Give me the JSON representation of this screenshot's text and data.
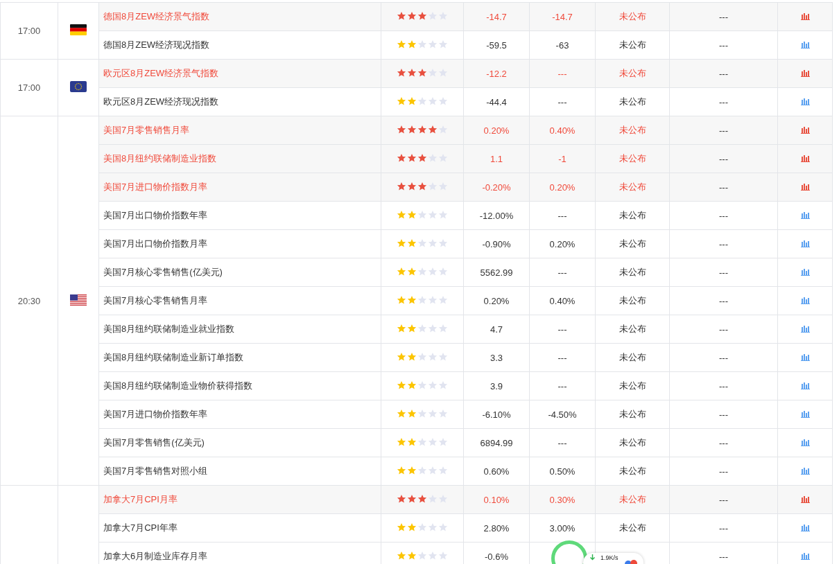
{
  "groups": [
    {
      "time": "17:00",
      "flag": {
        "kind": "de"
      },
      "rows": [
        {
          "name": "德国8月ZEW经济景气指数",
          "important": true,
          "stars": 3,
          "previous": "-14.7",
          "forecast": "-14.7",
          "actual": "未公布",
          "column_8": "---"
        },
        {
          "name": "德国8月ZEW经济现况指数",
          "important": false,
          "stars": 2,
          "previous": "-59.5",
          "forecast": "-63",
          "actual": "未公布",
          "column_8": "---"
        }
      ]
    },
    {
      "time": "17:00",
      "flag": {
        "kind": "eu"
      },
      "rows": [
        {
          "name": "欧元区8月ZEW经济景气指数",
          "important": true,
          "stars": 3,
          "previous": "-12.2",
          "forecast": "---",
          "actual": "未公布",
          "column_8": "---"
        },
        {
          "name": "欧元区8月ZEW经济现况指数",
          "important": false,
          "stars": 2,
          "previous": "-44.4",
          "forecast": "---",
          "actual": "未公布",
          "column_8": "---"
        }
      ]
    },
    {
      "time": "20:30",
      "flag": {
        "kind": "us"
      },
      "rows": [
        {
          "name": "美国7月零售销售月率",
          "important": true,
          "stars": 4,
          "previous": "0.20%",
          "forecast": "0.40%",
          "actual": "未公布",
          "column_8": "---"
        },
        {
          "name": "美国8月纽约联储制造业指数",
          "important": true,
          "stars": 3,
          "previous": "1.1",
          "forecast": "-1",
          "actual": "未公布",
          "column_8": "---"
        },
        {
          "name": "美国7月进口物价指数月率",
          "important": true,
          "stars": 3,
          "previous": "-0.20%",
          "forecast": "0.20%",
          "actual": "未公布",
          "column_8": "---"
        },
        {
          "name": "美国7月出口物价指数年率",
          "important": false,
          "stars": 2,
          "previous": "-12.00%",
          "forecast": "---",
          "actual": "未公布",
          "column_8": "---"
        },
        {
          "name": "美国7月出口物价指数月率",
          "important": false,
          "stars": 2,
          "previous": "-0.90%",
          "forecast": "0.20%",
          "actual": "未公布",
          "column_8": "---"
        },
        {
          "name": "美国7月核心零售销售(亿美元)",
          "important": false,
          "stars": 2,
          "previous": "5562.99",
          "forecast": "---",
          "actual": "未公布",
          "column_8": "---"
        },
        {
          "name": "美国7月核心零售销售月率",
          "important": false,
          "stars": 2,
          "previous": "0.20%",
          "forecast": "0.40%",
          "actual": "未公布",
          "column_8": "---"
        },
        {
          "name": "美国8月纽约联储制造业就业指数",
          "important": false,
          "stars": 2,
          "previous": "4.7",
          "forecast": "---",
          "actual": "未公布",
          "column_8": "---"
        },
        {
          "name": "美国8月纽约联储制造业新订单指数",
          "important": false,
          "stars": 2,
          "previous": "3.3",
          "forecast": "---",
          "actual": "未公布",
          "column_8": "---"
        },
        {
          "name": "美国8月纽约联储制造业物价获得指数",
          "important": false,
          "stars": 2,
          "previous": "3.9",
          "forecast": "---",
          "actual": "未公布",
          "column_8": "---"
        },
        {
          "name": "美国7月进口物价指数年率",
          "important": false,
          "stars": 2,
          "previous": "-6.10%",
          "forecast": "-4.50%",
          "actual": "未公布",
          "column_8": "---"
        },
        {
          "name": "美国7月零售销售(亿美元)",
          "important": false,
          "stars": 2,
          "previous": "6894.99",
          "forecast": "---",
          "actual": "未公布",
          "column_8": "---"
        },
        {
          "name": "美国7月零售销售对照小组",
          "important": false,
          "stars": 2,
          "previous": "0.60%",
          "forecast": "0.50%",
          "actual": "未公布",
          "column_8": "---"
        }
      ]
    },
    {
      "rows": [
        {
          "name": "加拿大7月CPI月率",
          "important": true,
          "stars": 3,
          "previous": "0.10%",
          "forecast": "0.30%",
          "actual": "未公布",
          "column_8": "---"
        },
        {
          "name": "加拿大7月CPI年率",
          "important": false,
          "stars": 2,
          "previous": "2.80%",
          "forecast": "3.00%",
          "actual": "未公布",
          "column_8": "---"
        },
        {
          "name": "加拿大6月制造业库存月率",
          "important": false,
          "stars": 2,
          "previous": "-0.6%",
          "column_8": "---"
        }
      ]
    }
  ],
  "speed_widget": {
    "speed": "1.9K/s"
  }
}
